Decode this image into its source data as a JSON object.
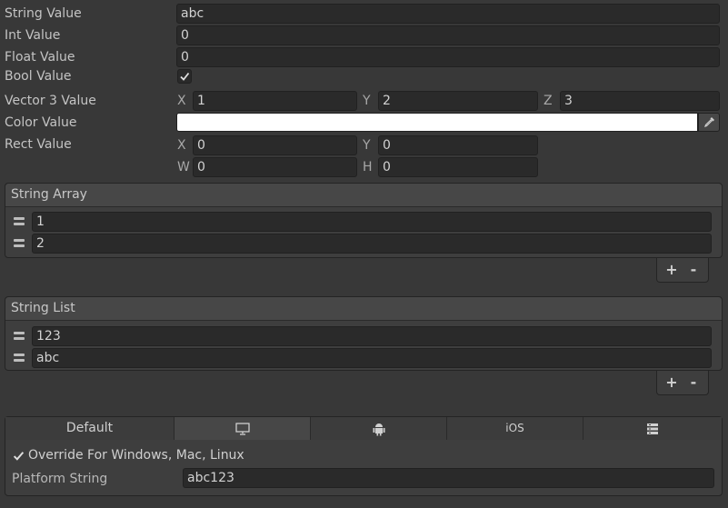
{
  "fields": {
    "string_value": {
      "label": "String Value",
      "value": "abc"
    },
    "int_value": {
      "label": "Int Value",
      "value": "0"
    },
    "float_value": {
      "label": "Float Value",
      "value": "0"
    },
    "bool_value": {
      "label": "Bool Value",
      "checked": true
    },
    "vector3_value": {
      "label": "Vector 3 Value",
      "x_label": "X",
      "x": "1",
      "y_label": "Y",
      "y": "2",
      "z_label": "Z",
      "z": "3"
    },
    "color_value": {
      "label": "Color Value",
      "color": "#ffffff",
      "picker_icon": "eyedropper-icon"
    },
    "rect_value": {
      "label": "Rect Value",
      "x_label": "X",
      "x": "0",
      "y_label": "Y",
      "y": "0",
      "w_label": "W",
      "w": "0",
      "h_label": "H",
      "h": "0"
    }
  },
  "string_array": {
    "title": "String Array",
    "items": [
      "1",
      "2"
    ],
    "add_label": "+",
    "remove_label": "-"
  },
  "string_list": {
    "title": "String List",
    "items": [
      "123",
      "abc"
    ],
    "add_label": "+",
    "remove_label": "-"
  },
  "platform": {
    "tabs": [
      {
        "label": "Default",
        "icon": ""
      },
      {
        "label": "",
        "icon": "monitor-icon"
      },
      {
        "label": "",
        "icon": "android-icon"
      },
      {
        "label": "iOS",
        "icon": ""
      },
      {
        "label": "",
        "icon": "server-icon"
      }
    ],
    "active_tab": 1,
    "override_label": "Override For Windows, Mac, Linux",
    "override_checked": true,
    "platform_string_label": "Platform String",
    "platform_string_value": "abc123"
  },
  "colors": {
    "background": "#383838",
    "field": "#2a2a2a",
    "text": "#c4c4c4"
  }
}
